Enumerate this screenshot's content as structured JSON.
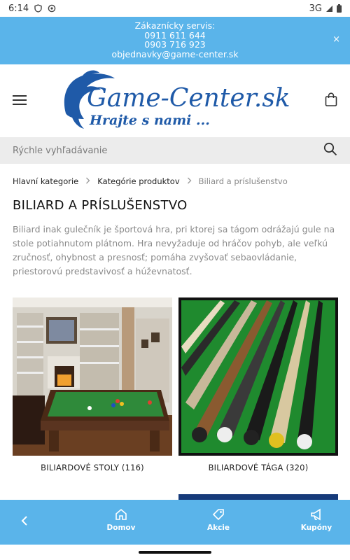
{
  "statusbar": {
    "time": "6:14",
    "network": "3G"
  },
  "promo": {
    "title": "Zákaznícky servis:",
    "phone1": "0911 611 644",
    "phone2": "0903 716 923",
    "email": "objednavky@game-center.sk",
    "close": "×"
  },
  "header": {
    "logo_text": "Game-Center.sk",
    "logo_slogan": "Hrajte s nami ..."
  },
  "search": {
    "placeholder": "Rýchle vyhľadávanie"
  },
  "breadcrumb": {
    "items": [
      "Hlavní kategorie",
      "Kategórie produktov",
      "Biliard a príslušenstvo"
    ]
  },
  "page": {
    "title": "BILIARD A PRÍSLUŠENSTVO",
    "description": "Biliard inak gulečník je športová hra, pri ktorej sa tágom odrážajú gule na stole potiahnutom plátnom. Hra nevyžaduje od hráčov pohyb, ale veľkú zručnosť, ohybnost a presnosť; pomáha zvyšovať sebaovládanie, priestorovú predstavivosť a húževnatosť."
  },
  "categories": [
    {
      "label": "BILIARDOVÉ STOLY (116)"
    },
    {
      "label": "BILIARDOVÉ TÁGA (320)"
    }
  ],
  "bottom_nav": {
    "home": "Domov",
    "deals": "Akcie",
    "coupons": "Kupóny"
  },
  "colors": {
    "accent": "#5ab4ea",
    "logo_blue": "#1f5aa8"
  }
}
